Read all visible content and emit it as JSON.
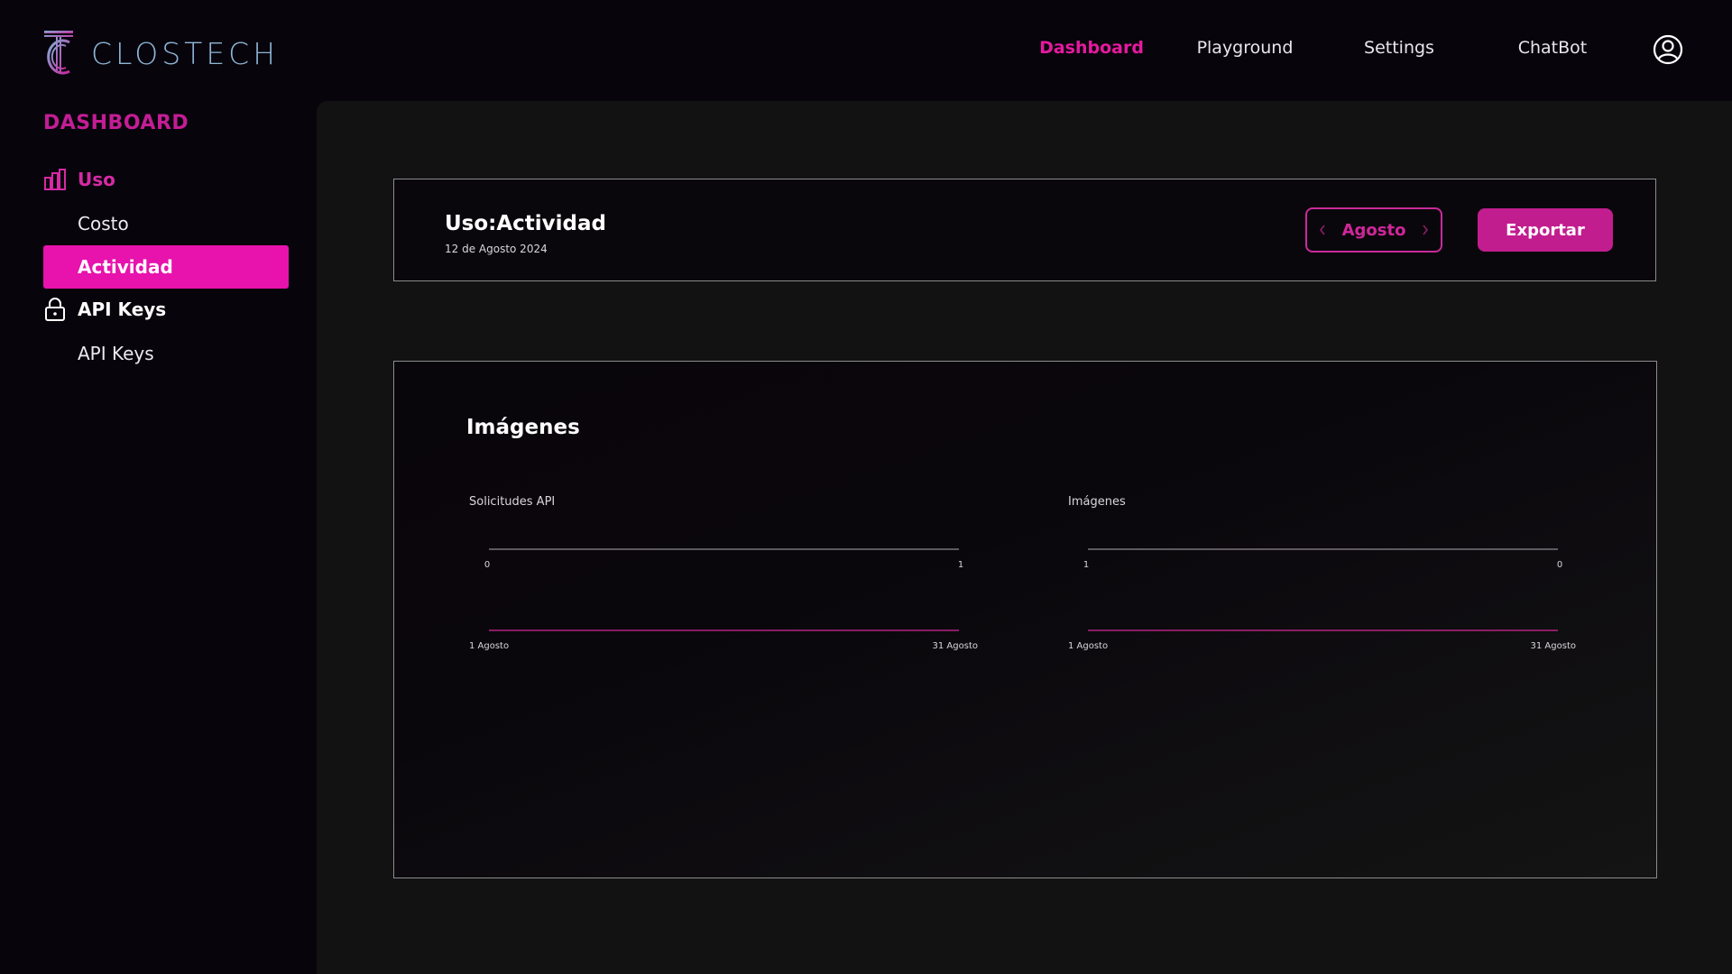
{
  "brand": {
    "name": "CLOSTECH"
  },
  "topnav": {
    "items": [
      {
        "label": "Dashboard",
        "active": true
      },
      {
        "label": "Playground",
        "active": false
      },
      {
        "label": "Settings",
        "active": false
      },
      {
        "label": "ChatBot",
        "active": false
      }
    ],
    "user_icon": "user-circle-icon"
  },
  "sidebar": {
    "heading": "DASHBOARD",
    "groups": [
      {
        "label": "Uso",
        "icon": "bar-chart-icon",
        "color": "#d52aa3",
        "items": [
          {
            "label": "Costo",
            "active": false
          },
          {
            "label": "Actividad",
            "active": true
          }
        ]
      },
      {
        "label": "API Keys",
        "icon": "lock-icon",
        "color": "#ffffff",
        "items": [
          {
            "label": "API Keys",
            "active": false
          }
        ]
      }
    ]
  },
  "header_card": {
    "title": "Uso:Actividad",
    "date": "12 de Agosto 2024",
    "month": "Agosto",
    "prev_icon": "chevron-left-icon",
    "next_icon": "chevron-right-icon",
    "export_label": "Exportar"
  },
  "charts_card": {
    "title": "Imágenes"
  },
  "chart_data": [
    {
      "type": "line",
      "title": "Solicitudes API",
      "top_axis_ticks": [
        "0",
        "1"
      ],
      "x": [
        "1 Agosto",
        "31 Agosto"
      ],
      "series": [
        {
          "values": [
            0,
            0
          ]
        }
      ],
      "color": "#b2247f"
    },
    {
      "type": "line",
      "title": "Imágenes",
      "top_axis_ticks": [
        "1",
        "0"
      ],
      "x": [
        "1 Agosto",
        "31 Agosto"
      ],
      "series": [
        {
          "values": [
            0,
            0
          ]
        }
      ],
      "color": "#b2247f"
    }
  ],
  "colors": {
    "accent": "#e812ad",
    "accent_dark": "#c21d8f",
    "background": "#07040c",
    "panel": "#121212"
  }
}
